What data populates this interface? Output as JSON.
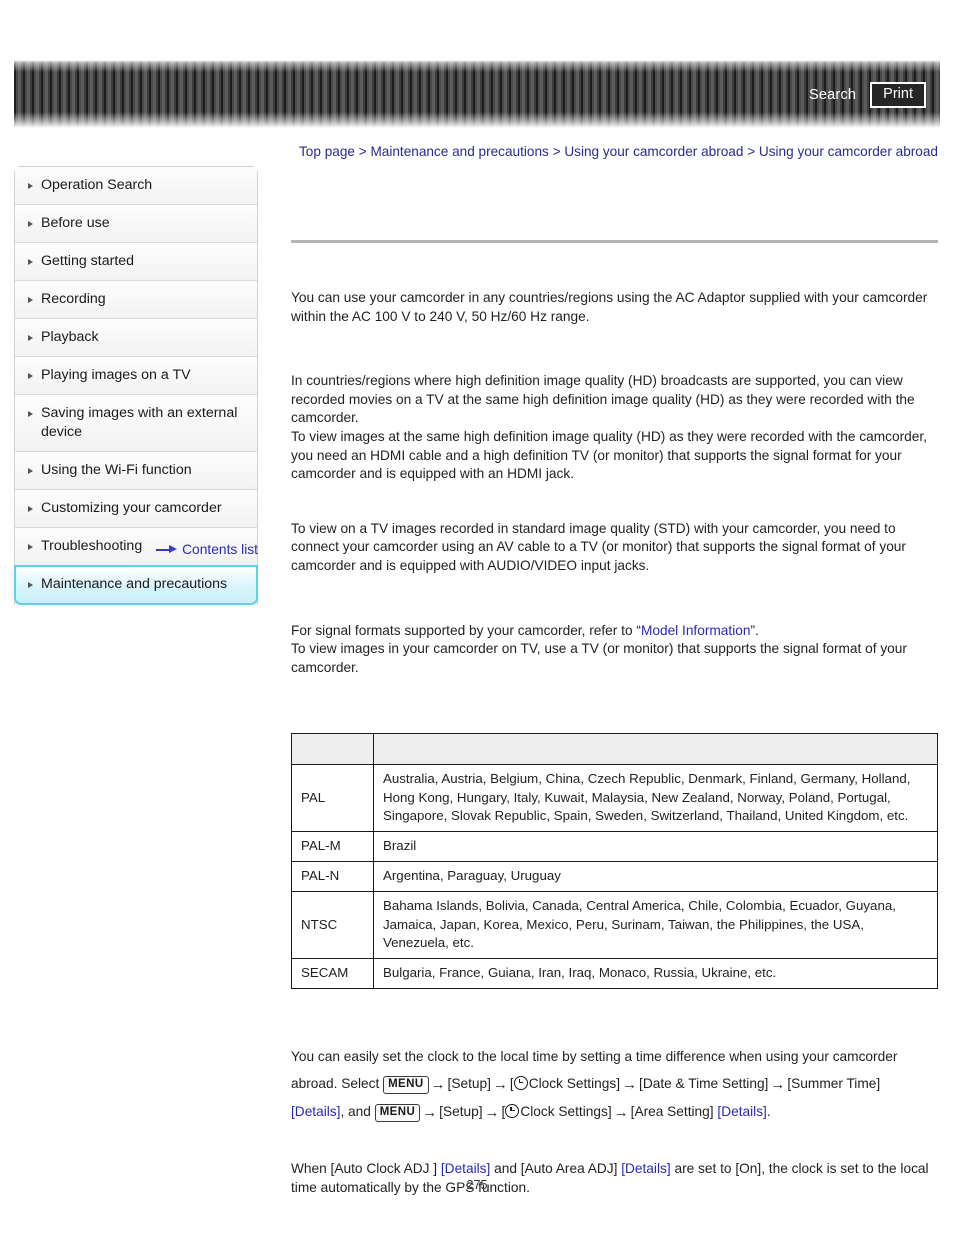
{
  "header": {
    "search_label": "Search",
    "print_label": "Print"
  },
  "breadcrumb": {
    "items": [
      "Top page",
      "Maintenance and precautions",
      "Using your camcorder abroad",
      "Using your camcorder abroad"
    ],
    "separator": ">"
  },
  "sidebar": {
    "items": [
      {
        "label": "Operation Search",
        "active": false
      },
      {
        "label": "Before use",
        "active": false
      },
      {
        "label": "Getting started",
        "active": false
      },
      {
        "label": "Recording",
        "active": false
      },
      {
        "label": "Playback",
        "active": false
      },
      {
        "label": "Playing images on a TV",
        "active": false
      },
      {
        "label": "Saving images with an external device",
        "active": false
      },
      {
        "label": "Using the Wi-Fi function",
        "active": false
      },
      {
        "label": "Customizing your camcorder",
        "active": false
      },
      {
        "label": "Troubleshooting",
        "active": false
      },
      {
        "label": "Maintenance and precautions",
        "active": true
      }
    ],
    "contents_list_label": "Contents list"
  },
  "content": {
    "para_power": "You can use your camcorder in any countries/regions using the AC Adaptor supplied with your camcorder within the AC 100 V to 240 V, 50 Hz/60 Hz range.",
    "para_hd": "In countries/regions where high definition image quality (HD) broadcasts are supported, you can view recorded movies on a TV at the same high definition image quality (HD) as they were recorded with the camcorder.\nTo view images at the same high definition image quality (HD) as they were recorded with the camcorder, you need an HDMI cable and a high definition TV (or monitor) that supports the signal format for your camcorder and is equipped with an HDMI jack.",
    "para_std": "To view on a TV images recorded in standard image quality (STD) with your camcorder, you need to connect your camcorder using an AV cable to a TV (or monitor) that supports the signal format of your camcorder and is equipped with AUDIO/VIDEO input jacks.",
    "para_signal_pre": "For signal formats supported by your camcorder, refer to “",
    "para_signal_link": "Model Information",
    "para_signal_post": "”.\nTo view images in your camcorder on TV, use a TV (or monitor) that supports the signal format of your camcorder.",
    "para_clock_a": "You can easily set the clock to the local time by setting a time difference when using your camcorder abroad. Select ",
    "menu_chip_label": "MENU",
    "arrow_glyph": "→",
    "clock_step_setup": "[Setup]",
    "clock_step_clock": "Clock Settings]",
    "clock_step_bracket_open": "[",
    "clock_step_datetime": "[Date & Time Setting]",
    "clock_step_summer": "[Summer Time]",
    "details_label": "[Details]",
    "clock_conj": ", and ",
    "clock_step_area": "[Area Setting]",
    "period": ".",
    "para_gps_1": "When [Auto Clock ADJ ] ",
    "para_gps_2": " and [Auto Area ADJ] ",
    "para_gps_3": " are set to [On], the clock is set to the local time automatically by the GPS function."
  },
  "table": {
    "header": [
      "",
      ""
    ],
    "rows": [
      {
        "system": "PAL",
        "countries": "Australia, Austria, Belgium, China, Czech Republic, Denmark, Finland, Germany, Holland, Hong Kong, Hungary, Italy, Kuwait, Malaysia, New Zealand, Norway, Poland, Portugal, Singapore, Slovak Republic, Spain, Sweden, Switzerland, Thailand, United Kingdom, etc."
      },
      {
        "system": "PAL-M",
        "countries": "Brazil"
      },
      {
        "system": "PAL-N",
        "countries": "Argentina, Paraguay, Uruguay"
      },
      {
        "system": "NTSC",
        "countries": "Bahama Islands, Bolivia, Canada, Central America, Chile, Colombia, Ecuador, Guyana, Jamaica, Japan, Korea, Mexico, Peru, Surinam, Taiwan, the Philippines, the USA, Venezuela, etc."
      },
      {
        "system": "SECAM",
        "countries": "Bulgaria, France, Guiana, Iran, Iraq, Monaco, Russia, Ukraine, etc."
      }
    ]
  },
  "footer": {
    "page_number": "275"
  },
  "colors": {
    "link": "#2a2ab0",
    "breadcrumb": "#2a2a8c",
    "active_border": "#5ad2ee",
    "table_header_bg": "#eeeeee",
    "rule": "#b5b5b5"
  }
}
